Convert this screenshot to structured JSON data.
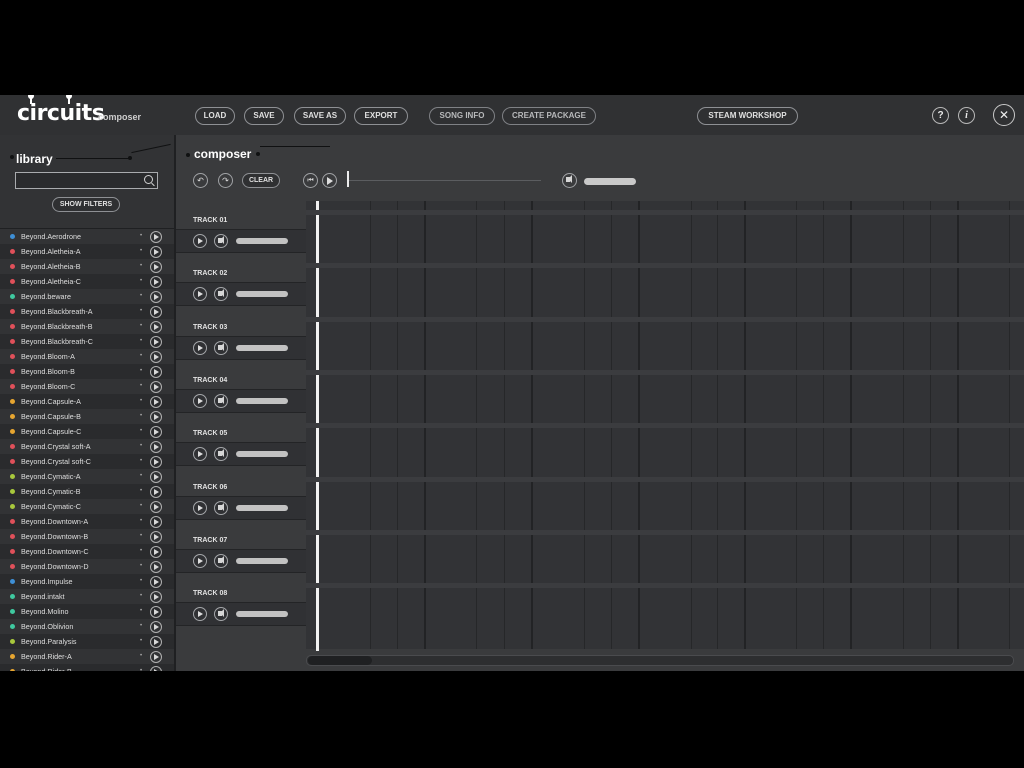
{
  "app": {
    "logo": "circuits",
    "logo_sub": "composer"
  },
  "toolbar": {
    "load": "LOAD",
    "save": "SAVE",
    "save_as": "SAVE AS",
    "export": "EXPORT",
    "song_info": "SONG INFO",
    "create_package": "CREATE PACKAGE",
    "steam_workshop": "STEAM WORKSHOP",
    "help": "?",
    "info": "i",
    "close": "✕"
  },
  "library": {
    "title": "library",
    "search_placeholder": "",
    "show_filters": "SHOW FILTERS",
    "items": [
      {
        "name": "Beyond.Aerodrone",
        "color": "#3e8fd6"
      },
      {
        "name": "Beyond.Aletheia-A",
        "color": "#e0505a"
      },
      {
        "name": "Beyond.Aletheia-B",
        "color": "#e0505a"
      },
      {
        "name": "Beyond.Aletheia-C",
        "color": "#e0505a"
      },
      {
        "name": "Beyond.beware",
        "color": "#3fc9a0"
      },
      {
        "name": "Beyond.Blackbreath-A",
        "color": "#e0505a"
      },
      {
        "name": "Beyond.Blackbreath-B",
        "color": "#e0505a"
      },
      {
        "name": "Beyond.Blackbreath-C",
        "color": "#e0505a"
      },
      {
        "name": "Beyond.Bloom-A",
        "color": "#e0505a"
      },
      {
        "name": "Beyond.Bloom-B",
        "color": "#e0505a"
      },
      {
        "name": "Beyond.Bloom-C",
        "color": "#e0505a"
      },
      {
        "name": "Beyond.Capsule-A",
        "color": "#e6a530"
      },
      {
        "name": "Beyond.Capsule-B",
        "color": "#e6a530"
      },
      {
        "name": "Beyond.Capsule-C",
        "color": "#e6a530"
      },
      {
        "name": "Beyond.Crystal soft-A",
        "color": "#e0505a"
      },
      {
        "name": "Beyond.Crystal soft-C",
        "color": "#e0505a"
      },
      {
        "name": "Beyond.Cymatic-A",
        "color": "#a8c83c"
      },
      {
        "name": "Beyond.Cymatic-B",
        "color": "#a8c83c"
      },
      {
        "name": "Beyond.Cymatic-C",
        "color": "#a8c83c"
      },
      {
        "name": "Beyond.Downtown-A",
        "color": "#e0505a"
      },
      {
        "name": "Beyond.Downtown-B",
        "color": "#e0505a"
      },
      {
        "name": "Beyond.Downtown-C",
        "color": "#e0505a"
      },
      {
        "name": "Beyond.Downtown-D",
        "color": "#e0505a"
      },
      {
        "name": "Beyond.Impulse",
        "color": "#3e8fd6"
      },
      {
        "name": "Beyond.intakt",
        "color": "#3fc9a0"
      },
      {
        "name": "Beyond.Molino",
        "color": "#3fc9a0"
      },
      {
        "name": "Beyond.Oblivion",
        "color": "#3fc9a0"
      },
      {
        "name": "Beyond.Paralysis",
        "color": "#a8c83c"
      },
      {
        "name": "Beyond.Rider-A",
        "color": "#e6a530"
      },
      {
        "name": "Beyond.Rider-B",
        "color": "#e6a530"
      }
    ]
  },
  "composer": {
    "title": "composer",
    "clear": "CLEAR",
    "undo_icon": "undo-icon",
    "redo_icon": "redo-icon",
    "tracks": [
      {
        "label": "TRACK 01"
      },
      {
        "label": "TRACK 02"
      },
      {
        "label": "TRACK 03"
      },
      {
        "label": "TRACK 04"
      },
      {
        "label": "TRACK 05"
      },
      {
        "label": "TRACK 06"
      },
      {
        "label": "TRACK 07"
      },
      {
        "label": "TRACK 08"
      }
    ]
  }
}
